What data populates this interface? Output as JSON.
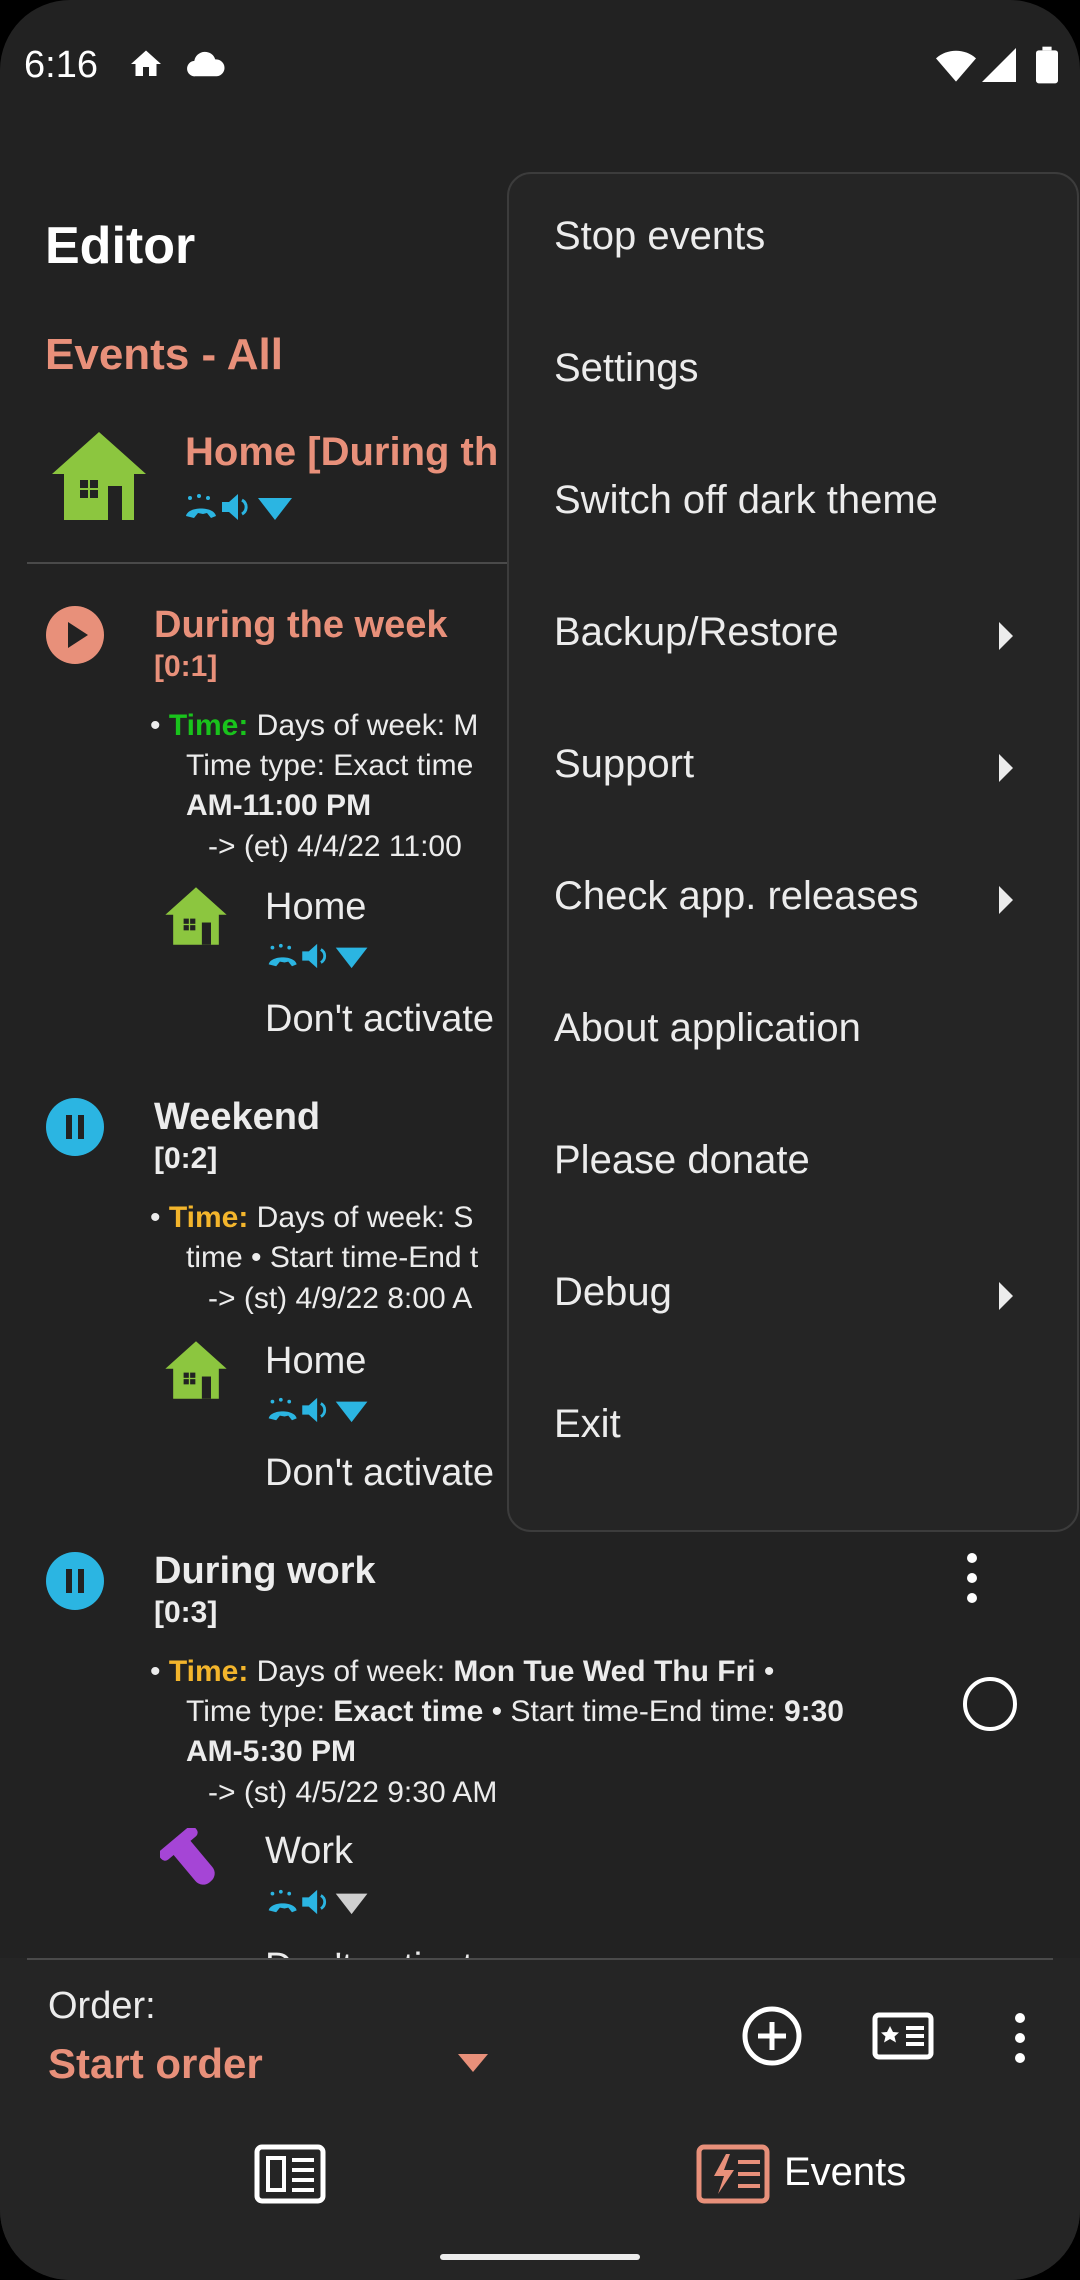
{
  "status_bar": {
    "time": "6:16"
  },
  "app_bar": {
    "title": "Editor"
  },
  "section_title": "Events - All",
  "activated_profile": {
    "name": "Home [During th"
  },
  "events": [
    {
      "name": "During the week",
      "id": "[0:1]",
      "state": "running",
      "name_color": "#e8907a",
      "cond_label": "Time:",
      "cond_color": "#19c31c",
      "cond_text_1": "Days of week: M",
      "cond_text_2": "Time type: Exact time",
      "cond_text_3": "AM-11:00 PM",
      "next": "-> (et) 4/4/22 11:00",
      "profile": "Home",
      "action": "Don't activate"
    },
    {
      "name": "Weekend",
      "id": "[0:2]",
      "state": "paused",
      "name_color": "#ececec",
      "cond_label": "Time:",
      "cond_color": "#f3b52c",
      "cond_text_1": "Days of week: S",
      "cond_text_2": "time • Start time-End t",
      "next": "-> (st) 4/9/22 8:00 A",
      "profile": "Home",
      "action": "Don't activate"
    },
    {
      "name": "During work",
      "id": "[0:3]",
      "state": "paused",
      "name_color": "#ececec",
      "cond_label": "Time:",
      "cond_color": "#f3b52c",
      "cond_text_1": "Days of week: ",
      "cond_days": "Mon Tue Wed Thu Fri",
      "cond_text_1b": " •",
      "cond_text_2a": "Time type: ",
      "cond_text_2b": "Exact time",
      "cond_text_2c": " • Start time-End time: ",
      "cond_text_2d": "9:30",
      "cond_text_3": "AM-5:30 PM",
      "next": "-> (st) 4/5/22 9:30 AM",
      "profile": "Work",
      "action": "Don't activate"
    }
  ],
  "bottom": {
    "order_label": "Order:",
    "order_value": "Start order",
    "nav_events_label": "Events"
  },
  "menu": {
    "items": [
      {
        "label": "Stop events",
        "submenu": false
      },
      {
        "label": "Settings",
        "submenu": false
      },
      {
        "label": "Switch off dark theme",
        "submenu": false
      },
      {
        "label": "Backup/Restore",
        "submenu": true
      },
      {
        "label": "Support",
        "submenu": true
      },
      {
        "label": "Check app. releases",
        "submenu": true
      },
      {
        "label": "About application",
        "submenu": false
      },
      {
        "label": "Please donate",
        "submenu": false
      },
      {
        "label": "Debug",
        "submenu": true
      },
      {
        "label": "Exit",
        "submenu": false
      }
    ]
  },
  "colors": {
    "accent": "#e8907a",
    "running": "#e8907a",
    "paused": "#2bb5e2",
    "home_icon": "#8cc63f",
    "work_icon": "#a545d6"
  }
}
